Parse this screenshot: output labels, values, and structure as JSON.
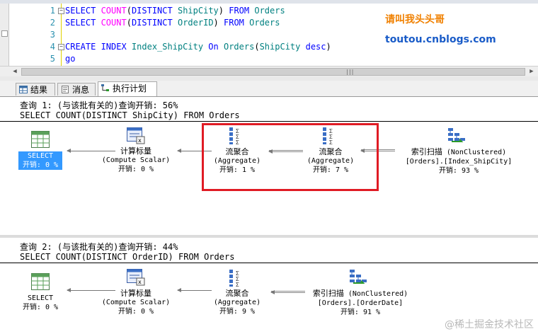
{
  "editor": {
    "lines": [
      {
        "num": "1",
        "parts": [
          [
            "kw",
            "SELECT "
          ],
          [
            "fn",
            "COUNT"
          ],
          [
            "tx",
            "("
          ],
          [
            "kw",
            "DISTINCT "
          ],
          [
            "id",
            "ShipCity"
          ],
          [
            "tx",
            ") "
          ],
          [
            "kw",
            "FROM "
          ],
          [
            "id",
            "Orders"
          ]
        ]
      },
      {
        "num": "2",
        "parts": [
          [
            "kw",
            "SELECT "
          ],
          [
            "fn",
            "COUNT"
          ],
          [
            "tx",
            "("
          ],
          [
            "kw",
            "DISTINCT "
          ],
          [
            "id",
            "OrderID"
          ],
          [
            "tx",
            ") "
          ],
          [
            "kw",
            "FROM "
          ],
          [
            "id",
            "Orders"
          ]
        ]
      },
      {
        "num": "3",
        "parts": []
      },
      {
        "num": "4",
        "parts": [
          [
            "kw",
            "CREATE INDEX "
          ],
          [
            "id",
            "Index_ShipCity "
          ],
          [
            "kw",
            "On "
          ],
          [
            "id",
            "Orders"
          ],
          [
            "tx",
            "("
          ],
          [
            "id",
            "ShipCity "
          ],
          [
            "kw",
            "desc"
          ],
          [
            "tx",
            ")"
          ]
        ]
      },
      {
        "num": "5",
        "parts": [
          [
            "kw",
            "go"
          ]
        ]
      }
    ],
    "brand_cn": "请叫我头头哥",
    "brand_url": "toutou.cnblogs.com"
  },
  "tabs": [
    {
      "label": "结果",
      "icon": "results-grid-icon"
    },
    {
      "label": "消息",
      "icon": "messages-icon"
    },
    {
      "label": "执行计划",
      "icon": "execution-plan-icon"
    }
  ],
  "plan1": {
    "header": "查询 1: (与该批有关的)查询开销: 56%",
    "sql": "SELECT COUNT(DISTINCT ShipCity) FROM Orders",
    "select": {
      "name": "SELECT",
      "cost": "开销: 0 %"
    },
    "compute": {
      "name": "计算标量",
      "sub": "(Compute Scalar)",
      "cost": "开销: 0 %"
    },
    "agg1": {
      "name": "流聚合",
      "sub": "(Aggregate)",
      "cost": "开销: 1 %"
    },
    "agg2": {
      "name": "流聚合",
      "sub": "(Aggregate)",
      "cost": "开销: 7 %"
    },
    "scan": {
      "name": "索引扫描",
      "type": "(NonClustered)",
      "obj": "[Orders].[Index_ShipCity]",
      "cost": "开销: 93 %"
    }
  },
  "plan2": {
    "header": "查询 2: (与该批有关的)查询开销: 44%",
    "sql": "SELECT COUNT(DISTINCT OrderID) FROM Orders",
    "select": {
      "name": "SELECT",
      "cost": "开销: 0 %"
    },
    "compute": {
      "name": "计算标量",
      "sub": "(Compute Scalar)",
      "cost": "开销: 0 %"
    },
    "agg": {
      "name": "流聚合",
      "sub": "(Aggregate)",
      "cost": "开销: 9 %"
    },
    "scan": {
      "name": "索引扫描",
      "type": "(NonClustered)",
      "obj": "[Orders].[OrderDate]",
      "cost": "开销: 91 %"
    }
  },
  "watermark": "@稀土掘金技术社区",
  "colors": {
    "keyword": "#0000ff",
    "function": "#ff00ff",
    "identifier": "#008080",
    "highlight_box": "#e01b24",
    "selected": "#3399ff"
  }
}
